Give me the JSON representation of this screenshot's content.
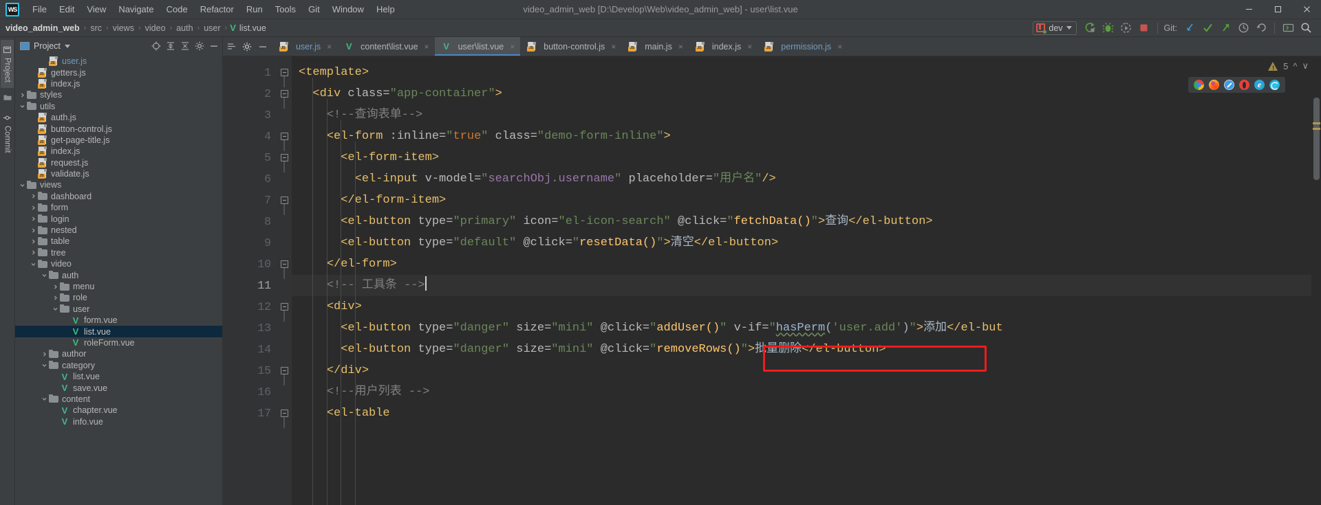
{
  "window": {
    "title": "video_admin_web [D:\\Develop\\Web\\video_admin_web] - user\\list.vue",
    "app_logo": "webstorm-logo",
    "minimize": "—",
    "maximize": "❑",
    "close": "✕"
  },
  "menu": [
    {
      "label": "File"
    },
    {
      "label": "Edit"
    },
    {
      "label": "View"
    },
    {
      "label": "Navigate"
    },
    {
      "label": "Code"
    },
    {
      "label": "Refactor"
    },
    {
      "label": "Run"
    },
    {
      "label": "Tools"
    },
    {
      "label": "Git"
    },
    {
      "label": "Window"
    },
    {
      "label": "Help"
    }
  ],
  "breadcrumb": {
    "root": "video_admin_web",
    "separator": "›",
    "items": [
      "src",
      "views",
      "video",
      "auth",
      "user"
    ],
    "leaf": "list.vue",
    "leaf_icon": "vue-file-icon"
  },
  "toolbar": {
    "run_config": "dev",
    "run_config_icon": "run-config-icon",
    "dropdown_icon": "chevron-down-icon",
    "buttons": [
      {
        "name": "run-button",
        "icon": "run-icon"
      },
      {
        "name": "debug-button",
        "icon": "debug-icon"
      },
      {
        "name": "run-with-coverage-button",
        "icon": "coverage-icon"
      },
      {
        "name": "stop-button",
        "icon": "stop-icon"
      }
    ],
    "git_label": "Git:",
    "git_buttons": [
      {
        "name": "git-update-button",
        "icon": "update-project-icon"
      },
      {
        "name": "git-commit-button",
        "icon": "checkmark-icon"
      },
      {
        "name": "git-push-button",
        "icon": "push-arrow-icon"
      },
      {
        "name": "git-history-button",
        "icon": "clock-icon"
      },
      {
        "name": "git-rollback-button",
        "icon": "rollback-icon"
      }
    ],
    "extra_buttons": [
      {
        "name": "terminal-button",
        "icon": "terminal-icon"
      },
      {
        "name": "search-everywhere-button",
        "icon": "search-icon"
      }
    ]
  },
  "rail": {
    "items": [
      {
        "label": "Project",
        "icon": "project-icon",
        "active": true
      },
      {
        "label": "",
        "icon": "folder-icon",
        "active": false
      },
      {
        "label": "Commit",
        "icon": "commit-icon",
        "active": false
      }
    ]
  },
  "project_panel": {
    "title": "Project",
    "dropdown_icon": "chevron-down-icon",
    "actions": [
      {
        "name": "select-opened-file-button",
        "icon": "target-icon"
      },
      {
        "name": "expand-all-button",
        "icon": "expand-all-icon"
      },
      {
        "name": "collapse-all-button",
        "icon": "collapse-all-icon"
      },
      {
        "name": "settings-button",
        "icon": "gear-icon"
      },
      {
        "name": "hide-button",
        "icon": "minimize-icon"
      }
    ],
    "tree": [
      {
        "label": "user.js",
        "type": "js",
        "depth": 4,
        "arrow": "none",
        "color": "blue"
      },
      {
        "label": "getters.js",
        "type": "js",
        "depth": 3,
        "arrow": "none",
        "color": "normal"
      },
      {
        "label": "index.js",
        "type": "js",
        "depth": 3,
        "arrow": "none",
        "color": "normal"
      },
      {
        "label": "styles",
        "type": "folder",
        "depth": 2,
        "arrow": "collapsed",
        "color": "normal"
      },
      {
        "label": "utils",
        "type": "folder",
        "depth": 2,
        "arrow": "expanded",
        "color": "normal"
      },
      {
        "label": "auth.js",
        "type": "js",
        "depth": 3,
        "arrow": "none",
        "color": "normal"
      },
      {
        "label": "button-control.js",
        "type": "js",
        "depth": 3,
        "arrow": "none",
        "color": "normal"
      },
      {
        "label": "get-page-title.js",
        "type": "js",
        "depth": 3,
        "arrow": "none",
        "color": "normal"
      },
      {
        "label": "index.js",
        "type": "js",
        "depth": 3,
        "arrow": "none",
        "color": "normal"
      },
      {
        "label": "request.js",
        "type": "js",
        "depth": 3,
        "arrow": "none",
        "color": "normal"
      },
      {
        "label": "validate.js",
        "type": "js",
        "depth": 3,
        "arrow": "none",
        "color": "normal"
      },
      {
        "label": "views",
        "type": "folder",
        "depth": 2,
        "arrow": "expanded",
        "color": "normal"
      },
      {
        "label": "dashboard",
        "type": "folder",
        "depth": 3,
        "arrow": "collapsed",
        "color": "normal"
      },
      {
        "label": "form",
        "type": "folder",
        "depth": 3,
        "arrow": "collapsed",
        "color": "normal"
      },
      {
        "label": "login",
        "type": "folder",
        "depth": 3,
        "arrow": "collapsed",
        "color": "normal"
      },
      {
        "label": "nested",
        "type": "folder",
        "depth": 3,
        "arrow": "collapsed",
        "color": "normal"
      },
      {
        "label": "table",
        "type": "folder",
        "depth": 3,
        "arrow": "collapsed",
        "color": "normal"
      },
      {
        "label": "tree",
        "type": "folder",
        "depth": 3,
        "arrow": "collapsed",
        "color": "normal"
      },
      {
        "label": "video",
        "type": "folder",
        "depth": 3,
        "arrow": "expanded",
        "color": "normal"
      },
      {
        "label": "auth",
        "type": "folder",
        "depth": 4,
        "arrow": "expanded",
        "color": "normal"
      },
      {
        "label": "menu",
        "type": "folder",
        "depth": 5,
        "arrow": "collapsed",
        "color": "normal"
      },
      {
        "label": "role",
        "type": "folder",
        "depth": 5,
        "arrow": "collapsed",
        "color": "normal"
      },
      {
        "label": "user",
        "type": "folder",
        "depth": 5,
        "arrow": "expanded",
        "color": "normal"
      },
      {
        "label": "form.vue",
        "type": "vue",
        "depth": 6,
        "arrow": "none",
        "color": "normal"
      },
      {
        "label": "list.vue",
        "type": "vue",
        "depth": 6,
        "arrow": "none",
        "color": "white",
        "selected": true
      },
      {
        "label": "roleForm.vue",
        "type": "vue",
        "depth": 6,
        "arrow": "none",
        "color": "normal"
      },
      {
        "label": "author",
        "type": "folder",
        "depth": 4,
        "arrow": "collapsed",
        "color": "normal"
      },
      {
        "label": "category",
        "type": "folder",
        "depth": 4,
        "arrow": "expanded",
        "color": "normal"
      },
      {
        "label": "list.vue",
        "type": "vue",
        "depth": 5,
        "arrow": "none",
        "color": "normal"
      },
      {
        "label": "save.vue",
        "type": "vue",
        "depth": 5,
        "arrow": "none",
        "color": "normal"
      },
      {
        "label": "content",
        "type": "folder",
        "depth": 4,
        "arrow": "expanded",
        "color": "normal"
      },
      {
        "label": "chapter.vue",
        "type": "vue",
        "depth": 5,
        "arrow": "none",
        "color": "normal"
      },
      {
        "label": "info.vue",
        "type": "vue",
        "depth": 5,
        "arrow": "none",
        "color": "normal"
      }
    ]
  },
  "editor": {
    "tab_tools": [
      {
        "name": "tab-list-button",
        "icon": "tab-list-icon"
      },
      {
        "name": "tab-settings-button",
        "icon": "gear-icon"
      },
      {
        "name": "hide-tabs-button",
        "icon": "minimize-icon"
      }
    ],
    "tabs": [
      {
        "label": "user.js",
        "type": "js",
        "active": false,
        "color": "blue"
      },
      {
        "label": "content\\list.vue",
        "type": "vue",
        "active": false,
        "color": "normal"
      },
      {
        "label": "user\\list.vue",
        "type": "vue",
        "active": true,
        "color": "normal"
      },
      {
        "label": "button-control.js",
        "type": "js",
        "active": false,
        "color": "normal"
      },
      {
        "label": "main.js",
        "type": "js",
        "active": false,
        "color": "normal"
      },
      {
        "label": "index.js",
        "type": "js",
        "active": false,
        "color": "normal"
      },
      {
        "label": "permission.js",
        "type": "js",
        "active": false,
        "color": "blue"
      }
    ],
    "close_icon": "×",
    "inspections": {
      "warning_icon": "warning-triangle-icon",
      "warning_count": "5",
      "prev_icon": "ⱏ",
      "next_icon": "ⱟ"
    },
    "browser_preview": [
      {
        "name": "chrome-icon",
        "label": "Chrome"
      },
      {
        "name": "firefox-icon",
        "label": "Firefox"
      },
      {
        "name": "safari-icon",
        "label": "Safari"
      },
      {
        "name": "opera-icon",
        "label": "Opera"
      },
      {
        "name": "internet-explorer-icon",
        "label": "Internet Explorer"
      },
      {
        "name": "edge-icon",
        "label": "Edge"
      }
    ],
    "current_line": 11,
    "line_numbers": [
      "1",
      "2",
      "3",
      "4",
      "5",
      "6",
      "7",
      "8",
      "9",
      "10",
      "11",
      "12",
      "13",
      "14",
      "15",
      "16",
      "17"
    ],
    "code_lines": [
      {
        "n": 1,
        "fold": true,
        "tokens": [
          {
            "t": "tag",
            "v": "<template>"
          }
        ]
      },
      {
        "n": 2,
        "fold": true,
        "tokens": [
          {
            "t": "txt",
            "v": "  "
          },
          {
            "t": "tag",
            "v": "<div "
          },
          {
            "t": "attr",
            "v": "class="
          },
          {
            "t": "str",
            "v": "\"app-container\""
          },
          {
            "t": "tag",
            "v": ">"
          }
        ]
      },
      {
        "n": 3,
        "fold": false,
        "tokens": [
          {
            "t": "txt",
            "v": "    "
          },
          {
            "t": "cmt",
            "v": "<!--查询表单-->"
          }
        ]
      },
      {
        "n": 4,
        "fold": true,
        "tokens": [
          {
            "t": "txt",
            "v": "    "
          },
          {
            "t": "tag",
            "v": "<el-form "
          },
          {
            "t": "attr",
            "v": ":inline="
          },
          {
            "t": "str",
            "v": "\""
          },
          {
            "t": "kw",
            "v": "true"
          },
          {
            "t": "str",
            "v": "\""
          },
          {
            "t": "attr",
            "v": " class="
          },
          {
            "t": "str",
            "v": "\"demo-form-inline\""
          },
          {
            "t": "tag",
            "v": ">"
          }
        ]
      },
      {
        "n": 5,
        "fold": true,
        "tokens": [
          {
            "t": "txt",
            "v": "      "
          },
          {
            "t": "tag",
            "v": "<el-form-item>"
          }
        ]
      },
      {
        "n": 6,
        "fold": false,
        "tokens": [
          {
            "t": "txt",
            "v": "        "
          },
          {
            "t": "tag",
            "v": "<el-input "
          },
          {
            "t": "attr",
            "v": "v-model="
          },
          {
            "t": "str",
            "v": "\""
          },
          {
            "t": "val",
            "v": "searchObj.username"
          },
          {
            "t": "str",
            "v": "\""
          },
          {
            "t": "attr",
            "v": " placeholder="
          },
          {
            "t": "str",
            "v": "\"用户名\""
          },
          {
            "t": "tag",
            "v": "/>"
          }
        ]
      },
      {
        "n": 7,
        "fold": true,
        "tokens": [
          {
            "t": "txt",
            "v": "      "
          },
          {
            "t": "tag",
            "v": "</el-form-item>"
          }
        ]
      },
      {
        "n": 8,
        "fold": false,
        "tokens": [
          {
            "t": "txt",
            "v": "      "
          },
          {
            "t": "tag",
            "v": "<el-button "
          },
          {
            "t": "attr",
            "v": "type="
          },
          {
            "t": "str",
            "v": "\"primary\""
          },
          {
            "t": "attr",
            "v": " icon="
          },
          {
            "t": "str",
            "v": "\"el-icon-search\""
          },
          {
            "t": "attr",
            "v": " @click="
          },
          {
            "t": "str",
            "v": "\""
          },
          {
            "t": "fn",
            "v": "fetchData()"
          },
          {
            "t": "str",
            "v": "\""
          },
          {
            "t": "tag",
            "v": ">"
          },
          {
            "t": "txt",
            "v": "查询"
          },
          {
            "t": "tag",
            "v": "</el-button>"
          }
        ]
      },
      {
        "n": 9,
        "fold": false,
        "tokens": [
          {
            "t": "txt",
            "v": "      "
          },
          {
            "t": "tag",
            "v": "<el-button "
          },
          {
            "t": "attr",
            "v": "type="
          },
          {
            "t": "str",
            "v": "\"default\""
          },
          {
            "t": "attr",
            "v": " @click="
          },
          {
            "t": "str",
            "v": "\""
          },
          {
            "t": "fn",
            "v": "resetData()"
          },
          {
            "t": "str",
            "v": "\""
          },
          {
            "t": "tag",
            "v": ">"
          },
          {
            "t": "txt",
            "v": "清空"
          },
          {
            "t": "tag",
            "v": "</el-button>"
          }
        ]
      },
      {
        "n": 10,
        "fold": true,
        "tokens": [
          {
            "t": "txt",
            "v": "    "
          },
          {
            "t": "tag",
            "v": "</el-form>"
          }
        ]
      },
      {
        "n": 11,
        "fold": false,
        "current": true,
        "tokens": [
          {
            "t": "txt",
            "v": "    "
          },
          {
            "t": "cmt",
            "v": "<!-- 工具条 -->"
          },
          {
            "t": "caret",
            "v": ""
          }
        ]
      },
      {
        "n": 12,
        "fold": true,
        "tokens": [
          {
            "t": "txt",
            "v": "    "
          },
          {
            "t": "tag",
            "v": "<div>"
          }
        ]
      },
      {
        "n": 13,
        "fold": false,
        "tokens": [
          {
            "t": "txt",
            "v": "      "
          },
          {
            "t": "tag",
            "v": "<el-button "
          },
          {
            "t": "attr",
            "v": "type="
          },
          {
            "t": "str",
            "v": "\"danger\""
          },
          {
            "t": "attr",
            "v": " size="
          },
          {
            "t": "str",
            "v": "\"mini\""
          },
          {
            "t": "attr",
            "v": " @click="
          },
          {
            "t": "str",
            "v": "\""
          },
          {
            "t": "fn",
            "v": "addUser()"
          },
          {
            "t": "str",
            "v": "\""
          },
          {
            "t": "attr",
            "v": " v-if="
          },
          {
            "t": "str",
            "v": "\""
          },
          {
            "t": "squig",
            "v": "hasPerm"
          },
          {
            "t": "punc",
            "v": "("
          },
          {
            "t": "str",
            "v": "'user.add'"
          },
          {
            "t": "punc",
            "v": ")"
          },
          {
            "t": "str",
            "v": "\""
          },
          {
            "t": "tag",
            "v": ">"
          },
          {
            "t": "txt",
            "v": "添加"
          },
          {
            "t": "tag",
            "v": "</el-but"
          }
        ]
      },
      {
        "n": 14,
        "fold": false,
        "tokens": [
          {
            "t": "txt",
            "v": "      "
          },
          {
            "t": "tag",
            "v": "<el-button "
          },
          {
            "t": "attr",
            "v": "type="
          },
          {
            "t": "str",
            "v": "\"danger\""
          },
          {
            "t": "attr",
            "v": " size="
          },
          {
            "t": "str",
            "v": "\"mini\""
          },
          {
            "t": "attr",
            "v": " @click="
          },
          {
            "t": "str",
            "v": "\""
          },
          {
            "t": "fn",
            "v": "removeRows()"
          },
          {
            "t": "str",
            "v": "\""
          },
          {
            "t": "tag",
            "v": ">"
          },
          {
            "t": "txt",
            "v": "批量删除"
          },
          {
            "t": "tag",
            "v": "</el-button>"
          }
        ]
      },
      {
        "n": 15,
        "fold": true,
        "tokens": [
          {
            "t": "txt",
            "v": "    "
          },
          {
            "t": "tag",
            "v": "</div>"
          }
        ]
      },
      {
        "n": 16,
        "fold": false,
        "tokens": [
          {
            "t": "txt",
            "v": "    "
          },
          {
            "t": "cmt",
            "v": "<!--用户列表 -->"
          }
        ]
      },
      {
        "n": 17,
        "fold": true,
        "tokens": [
          {
            "t": "txt",
            "v": "    "
          },
          {
            "t": "tag",
            "v": "<el-table"
          }
        ]
      }
    ],
    "annotation": {
      "name": "red-highlight-box",
      "color": "#f01c1c",
      "target_text": "v-if=\"hasPerm('user.add')\">"
    }
  }
}
